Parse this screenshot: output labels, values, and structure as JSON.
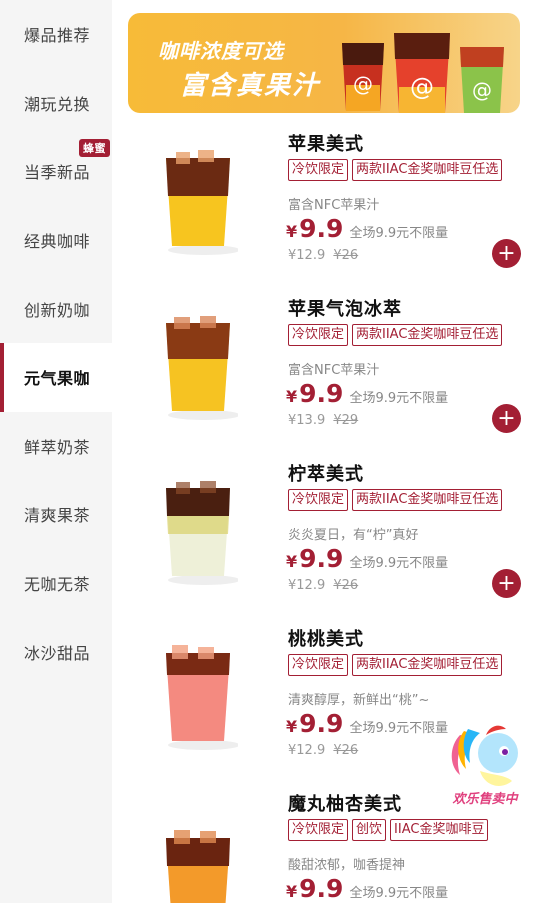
{
  "sidebar": {
    "items": [
      {
        "label": "爆品推荐"
      },
      {
        "label": "潮玩兑换"
      },
      {
        "label": "当季新品",
        "badge": "蜂蜜"
      },
      {
        "label": "经典咖啡"
      },
      {
        "label": "创新奶咖"
      },
      {
        "label": "元气果咖",
        "active": true
      },
      {
        "label": "鲜萃奶茶"
      },
      {
        "label": "清爽果茶"
      },
      {
        "label": "无咖无茶"
      },
      {
        "label": "冰沙甜品"
      }
    ]
  },
  "banner": {
    "line1": "咖啡浓度可选",
    "line2": "富含真果汁",
    "cup_icon": "at-symbol-cup-icon"
  },
  "products": [
    {
      "name": "苹果美式",
      "tags": [
        "冷饮限定",
        "两款IIAC金奖咖啡豆任选"
      ],
      "desc": "富含NFC苹果汁",
      "currency": "¥",
      "price": "9.9",
      "promo": "全场9.9元不限量",
      "orig_price": "¥12.9",
      "list_price": "¥26",
      "colors": {
        "top": "#6b2a12",
        "bottom": "#f7c51f"
      }
    },
    {
      "name": "苹果气泡冰萃",
      "tags": [
        "冷饮限定",
        "两款IIAC金奖咖啡豆任选"
      ],
      "desc": "富含NFC苹果汁",
      "currency": "¥",
      "price": "9.9",
      "promo": "全场9.9元不限量",
      "orig_price": "¥13.9",
      "list_price": "¥29",
      "colors": {
        "top": "#8a3a14",
        "bottom": "#f6c322"
      }
    },
    {
      "name": "柠萃美式",
      "tags": [
        "冷饮限定",
        "两款IIAC金奖咖啡豆任选"
      ],
      "desc": "炎炎夏日，有“柠”真好",
      "currency": "¥",
      "price": "9.9",
      "promo": "全场9.9元不限量",
      "orig_price": "¥12.9",
      "list_price": "¥26",
      "colors": {
        "top": "#4a1f10",
        "bottom": "#eef0d8"
      }
    },
    {
      "name": "桃桃美式",
      "tags": [
        "冷饮限定",
        "两款IIAC金奖咖啡豆任选"
      ],
      "desc": "清爽醇厚，新鲜出“桃”~",
      "currency": "¥",
      "price": "9.9",
      "promo": "全场9.9元不限量",
      "orig_price": "¥12.9",
      "list_price": "¥26",
      "colors": {
        "top": "#7a2a14",
        "bottom": "#f48a80"
      }
    },
    {
      "name": "魔丸柚杏美式",
      "tags": [
        "冷饮限定",
        "创饮",
        "IIAC金奖咖啡豆"
      ],
      "desc": "酸甜浓郁，咖香提神",
      "currency": "¥",
      "price": "9.9",
      "promo": "全场9.9元不限量",
      "orig_price": "",
      "list_price": "",
      "colors": {
        "top": "#6a2410",
        "bottom": "#f39a2a"
      }
    }
  ],
  "add_button": {
    "icon": "plus-icon",
    "symbol": "+"
  },
  "mascot": {
    "label": "欢乐售卖中",
    "icon": "pony-mascot-icon"
  },
  "accent_color": "#a31f34"
}
